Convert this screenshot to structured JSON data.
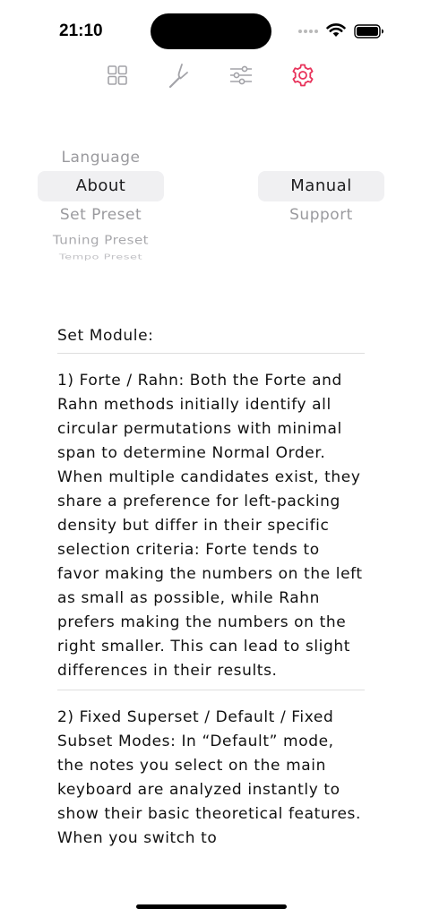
{
  "status_bar": {
    "time": "21:10"
  },
  "tabs": [
    {
      "icon": "grid-icon",
      "selected": false
    },
    {
      "icon": "tuning-fork-icon",
      "selected": false
    },
    {
      "icon": "sliders-icon",
      "selected": false
    },
    {
      "icon": "gear-icon",
      "selected": true
    }
  ],
  "colors": {
    "accent": "#e8325a",
    "inactive_icon": "#a3a3a8"
  },
  "picker_left": {
    "above": "Language",
    "selected": "About",
    "below": [
      "Set Preset",
      "Tuning Preset",
      "Tempo Preset"
    ]
  },
  "picker_right": {
    "selected": "Manual",
    "below": [
      "Support"
    ]
  },
  "content": {
    "section_title": "Set Module:",
    "paragraphs": [
      "1) Forte / Rahn: Both the Forte and Rahn methods initially identify all circular permutations with minimal span to determine Normal Order. When multiple candidates exist, they share a preference for left-packing density but differ in their specific selection criteria: Forte tends to favor making the numbers on the left as small as possible, while Rahn prefers making the numbers on the right smaller. This can lead to slight differences in their results.",
      "2) Fixed Superset / Default / Fixed Subset Modes: In “Default” mode, the notes you select on the main keyboard are analyzed instantly to show their basic theoretical features. When you switch to"
    ]
  }
}
